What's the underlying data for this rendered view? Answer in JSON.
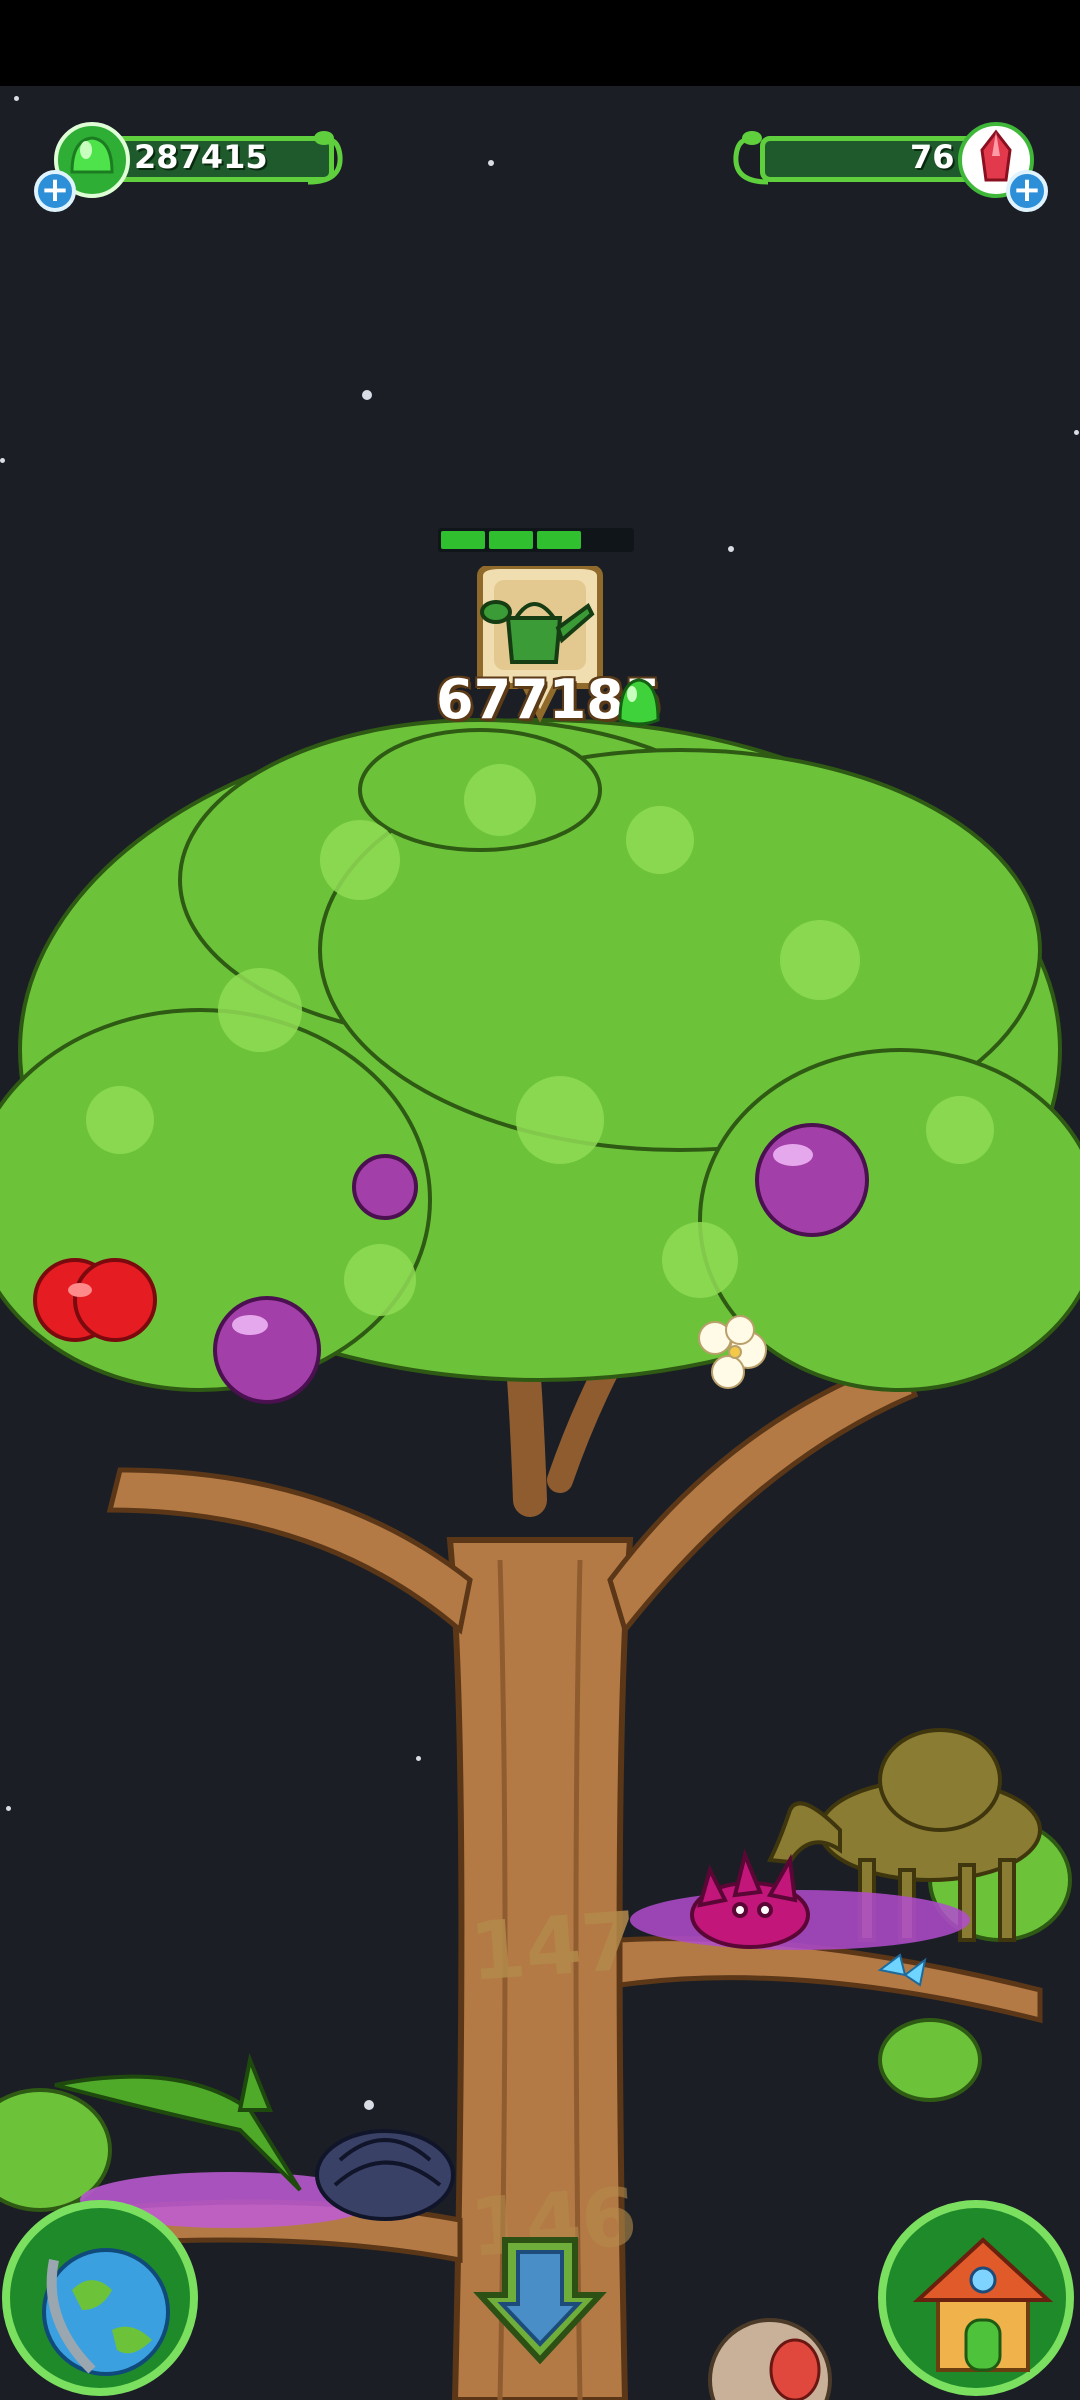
{
  "hud": {
    "currency_left": {
      "value": "287415",
      "icon": "green-gem-icon",
      "add_icon": "plus-icon"
    },
    "currency_right": {
      "value": "76",
      "icon": "red-crystal-icon",
      "add_icon": "plus-icon"
    }
  },
  "task": {
    "progress_filled": 3,
    "progress_total": 4,
    "icon": "watering-can-icon",
    "cost": "677185",
    "cost_icon": "green-gem-icon"
  },
  "levels": {
    "upper": "147",
    "lower": "146"
  },
  "buttons": {
    "globe": "globe-icon",
    "scroll_down": "down-arrow-icon",
    "home": "house-icon"
  },
  "colors": {
    "background": "#1b1f25",
    "leaf": "#6cc33a",
    "trunk": "#b47a45",
    "gem": "#3fd23a"
  }
}
